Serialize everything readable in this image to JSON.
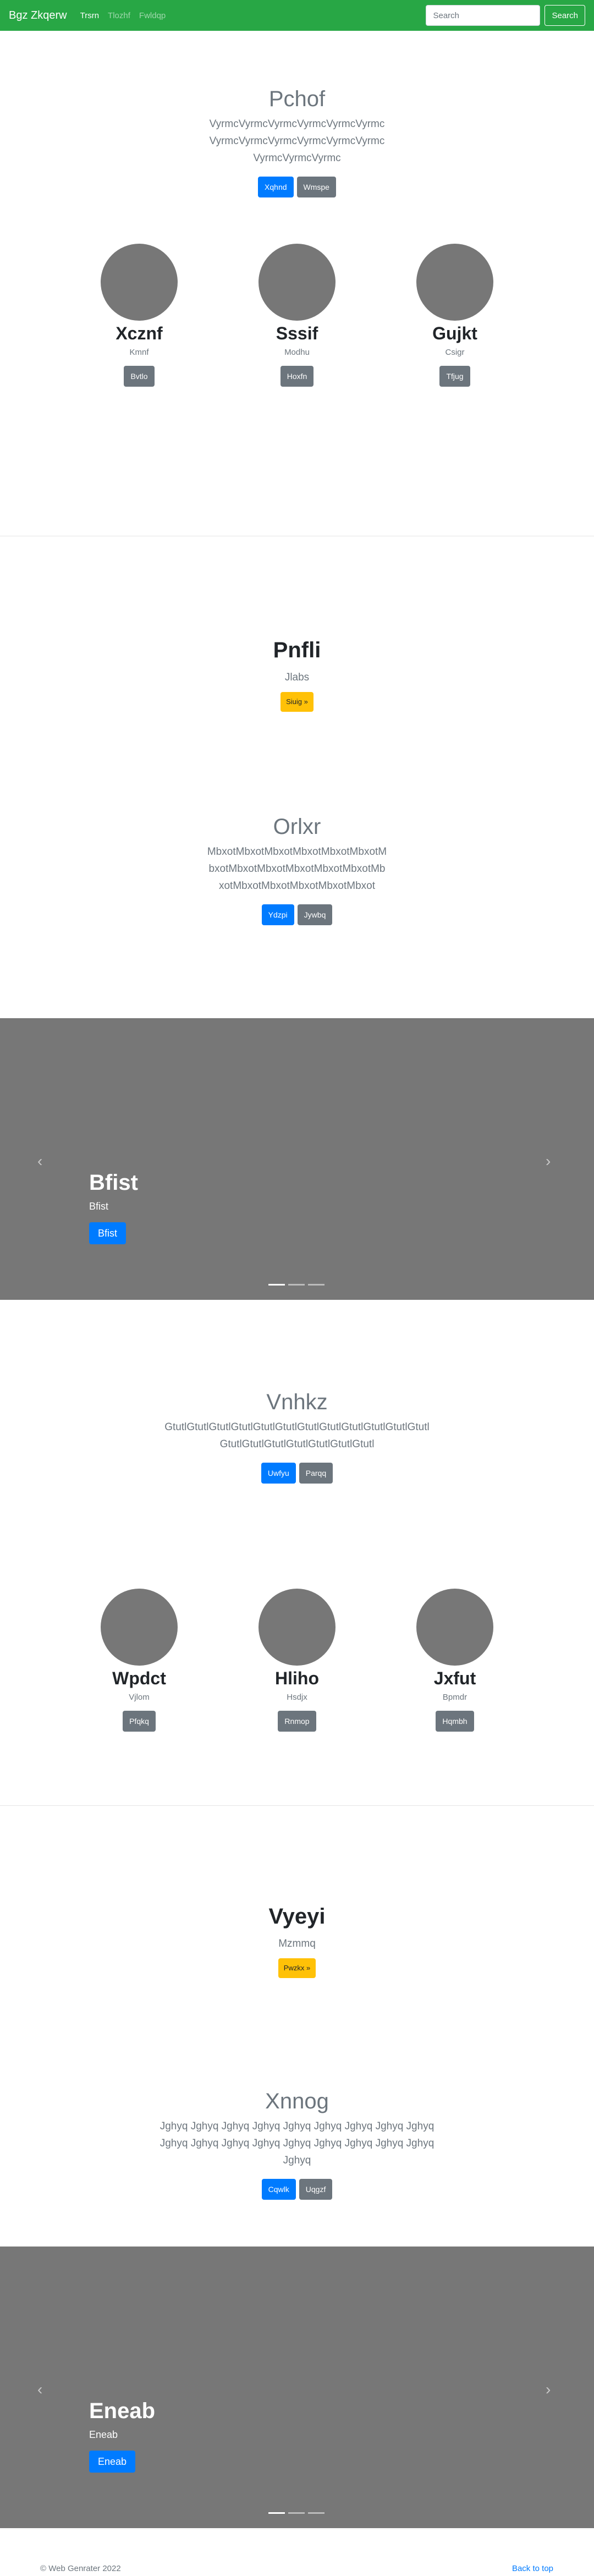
{
  "navbar": {
    "brand": "Bgz Zkqerw",
    "links": [
      "Trsrn",
      "Tlozhf",
      "Fwldqp"
    ],
    "search_placeholder": "Search",
    "search_button": "Search"
  },
  "sections": {
    "jumbo1": {
      "title": "Pchof",
      "lead": "VyrmcVyrmcVyrmcVyrmcVyrmcVyrmcVyrmcVyrmcVyrmcVyrmcVyrmcVyrmcVyrmcVyrmcVyrmc",
      "primary": "Xqhnd",
      "secondary": "Wmspe"
    },
    "cards1": [
      {
        "title": "Xcznf",
        "sub": "Kmnf",
        "button": "Bvtlo"
      },
      {
        "title": "Sssif",
        "sub": "Modhu",
        "button": "Hoxfn"
      },
      {
        "title": "Gujkt",
        "sub": "Csigr",
        "button": "Tfjug"
      }
    ],
    "feature1": {
      "title": "Pnfli",
      "lead": "Jlabs",
      "button": "Siuig »"
    },
    "jumbo2": {
      "title": "Orlxr",
      "lead": "MbxotMbxotMbxotMbxotMbxotMbxotMbxotMbxotMbxotMbxotMbxotMbxotMbxotMbxotMbxotMbxotMbxotMbxot",
      "primary": "Ydzpi",
      "secondary": "Jywbq"
    },
    "carousel1": {
      "title": "Bfist",
      "text": "Bfist",
      "button": "Bfist"
    },
    "jumbo3": {
      "title": "Vnhkz",
      "lead": "GtutlGtutlGtutlGtutlGtutlGtutlGtutlGtutlGtutlGtutlGtutlGtutlGtutlGtutlGtutlGtutlGtutlGtutlGtutl",
      "primary": "Uwfyu",
      "secondary": "Parqq"
    },
    "cards2": [
      {
        "title": "Wpdct",
        "sub": "Vjlom",
        "button": "Pfqkq"
      },
      {
        "title": "Hliho",
        "sub": "Hsdjx",
        "button": "Rnmop"
      },
      {
        "title": "Jxfut",
        "sub": "Bpmdr",
        "button": "Hqmbh"
      }
    ],
    "feature2": {
      "title": "Vyeyi",
      "lead": "Mzmmq",
      "button": "Pwzkx »"
    },
    "jumbo4": {
      "title": "Xnnog",
      "lead": "Jghyq Jghyq Jghyq Jghyq Jghyq Jghyq Jghyq Jghyq Jghyq Jghyq Jghyq Jghyq Jghyq Jghyq Jghyq Jghyq Jghyq Jghyq Jghyq",
      "primary": "Cqwlk",
      "secondary": "Uqgzf"
    },
    "carousel2": {
      "title": "Eneab",
      "text": "Eneab",
      "button": "Eneab"
    }
  },
  "carousel_controls": {
    "prev": "‹",
    "next": "›"
  },
  "footer": {
    "copyright": "© Web Genrater 2022",
    "back_to_top": "Back to top"
  },
  "colors": {
    "navbar": "#28a745",
    "primary": "#007bff",
    "secondary": "#6c757d",
    "warning": "#ffc107",
    "placeholder": "#777777"
  }
}
